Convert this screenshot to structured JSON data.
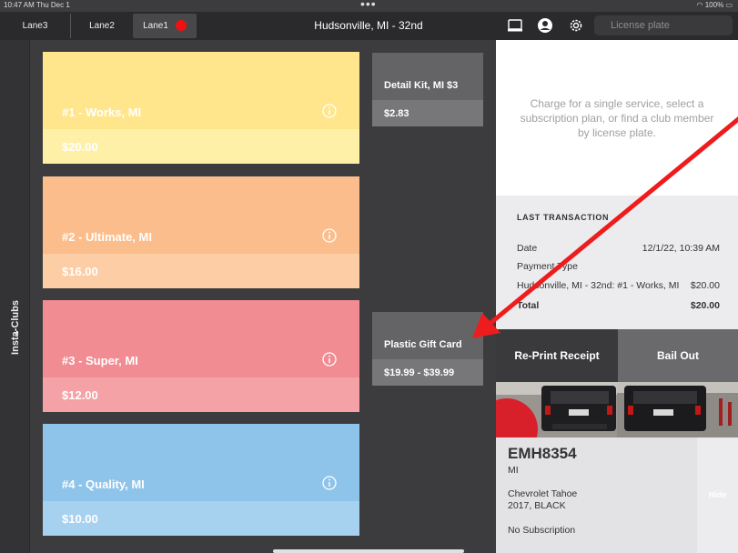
{
  "status_bar": {
    "time": "10:47 AM  Thu Dec 1",
    "battery": "100%"
  },
  "lanes": [
    "Lane3",
    "Lane2",
    "Lane1"
  ],
  "location_title": "Hudsonville, MI - 32nd",
  "search": {
    "placeholder": "License plate"
  },
  "sidebar_label": "Insta-Clubs",
  "packages": [
    {
      "name": "#1 - Works, MI",
      "price": "$20.00",
      "color_top": "#ffe68c",
      "color_bottom": "#fff0a8"
    },
    {
      "name": "#2 - Ultimate, MI",
      "price": "$16.00",
      "color_top": "#fbbd8c",
      "color_bottom": "#fdcda5"
    },
    {
      "name": "#3 - Super, MI",
      "price": "$12.00",
      "color_top": "#f08c92",
      "color_bottom": "#f4a2a6"
    },
    {
      "name": "#4 - Quality, MI",
      "price": "$10.00",
      "color_top": "#8ec4ea",
      "color_bottom": "#a6d2f0"
    }
  ],
  "addons": [
    {
      "name": "Detail Kit, MI  $3",
      "price": "$2.83"
    },
    {
      "name": "Plastic Gift Card",
      "price": "$19.99 - $39.99"
    }
  ],
  "hint_text": "Charge for a single service, select a subscription plan, or find a club member by license plate.",
  "last_transaction": {
    "title": "LAST TRANSACTION",
    "date_label": "Date",
    "date_value": "12/1/22, 10:39 AM",
    "payment_type_label": "Payment Type",
    "item_label": "Hudsonville, MI - 32nd: #1 - Works, MI",
    "item_value": "$20.00",
    "total_label": "Total",
    "total_value": "$20.00"
  },
  "buttons": {
    "reprint": "Re-Print Receipt",
    "bail": "Bail Out"
  },
  "vehicle": {
    "plate": "EMH8354",
    "state": "MI",
    "model": "Chevrolet Tahoe",
    "year_color": "2017, BLACK",
    "subscription": "No Subscription",
    "hide_label": "Hide"
  },
  "colors": {
    "accent_red": "#ee1111",
    "annotation_arrow": "#ee1c1c"
  }
}
